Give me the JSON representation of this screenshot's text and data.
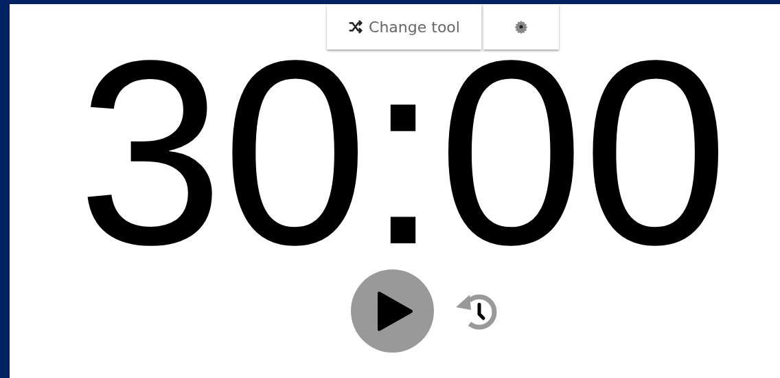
{
  "toolbar": {
    "change_tool": {
      "label": "Change tool"
    }
  },
  "timer": {
    "time": "30:00",
    "running": false
  }
}
